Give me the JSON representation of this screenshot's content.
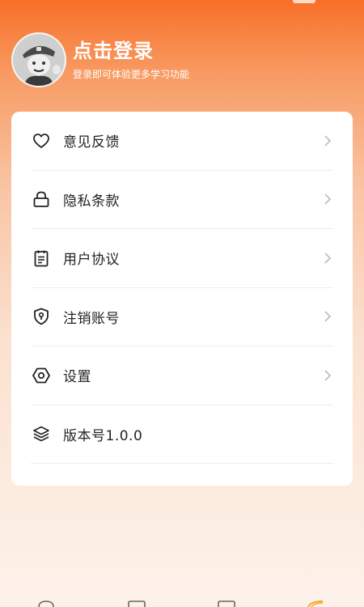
{
  "profile": {
    "title": "点击登录",
    "subtitle": "登录即可体验更多学习功能"
  },
  "menu": {
    "items": [
      {
        "label": "意见反馈",
        "icon": "heart-icon",
        "has_arrow": true
      },
      {
        "label": "隐私条款",
        "icon": "lock-icon",
        "has_arrow": true
      },
      {
        "label": "用户协议",
        "icon": "clipboard-icon",
        "has_arrow": true
      },
      {
        "label": "注销账号",
        "icon": "shield-keyhole-icon",
        "has_arrow": true
      },
      {
        "label": "设置",
        "icon": "hexagon-settings-icon",
        "has_arrow": true
      },
      {
        "label": "版本号1.0.0",
        "icon": "layers-icon",
        "has_arrow": false
      }
    ]
  },
  "colors": {
    "header_orange": "#f86f28",
    "accent_orange": "#f5a623",
    "card_bg": "#ffffff",
    "text": "#222222",
    "chevron": "#bbbbbb",
    "divider": "#eeeeee"
  }
}
